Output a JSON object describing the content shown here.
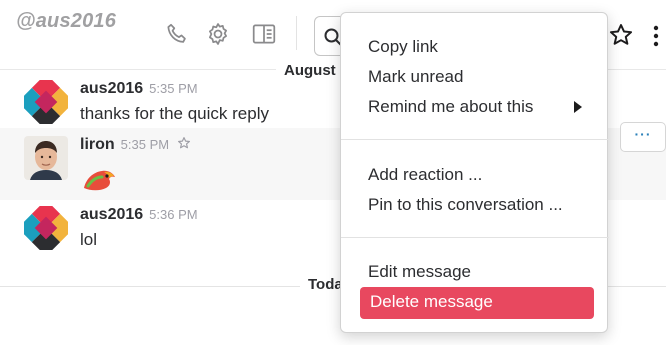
{
  "header": {
    "channel_name": "@aus2016",
    "icons": [
      "phone-icon",
      "gear-icon",
      "sidebar-panel-icon",
      "search-icon",
      "star-icon",
      "kebab-menu-icon"
    ]
  },
  "dividers": {
    "first_label": "August",
    "second_label": "Toda"
  },
  "messages": [
    {
      "sender": "aus2016",
      "time": "5:35 PM",
      "text": "thanks for the quick reply"
    },
    {
      "sender": "liron",
      "time": "5:35 PM",
      "text": ""
    },
    {
      "sender": "aus2016",
      "time": "5:36 PM",
      "text": "lol"
    }
  ],
  "hover_actions": {
    "more_label": "···"
  },
  "context_menu": {
    "groups": [
      [
        "Copy link",
        "Mark unread",
        "Remind me about this"
      ],
      [
        "Add reaction ...",
        "Pin to this conversation ..."
      ],
      [
        "Edit message",
        "Delete message"
      ]
    ]
  },
  "colors": {
    "danger": "#e8485f",
    "link_blue": "#2a80b9",
    "muted": "#9e9ea6"
  }
}
